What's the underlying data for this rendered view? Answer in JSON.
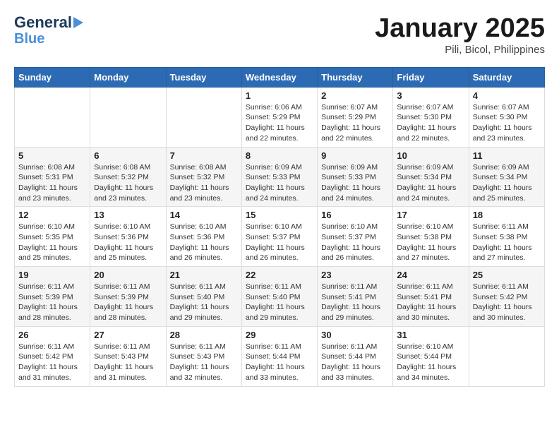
{
  "header": {
    "logo_line1": "General",
    "logo_line2": "Blue",
    "month": "January 2025",
    "location": "Pili, Bicol, Philippines"
  },
  "days_of_week": [
    "Sunday",
    "Monday",
    "Tuesday",
    "Wednesday",
    "Thursday",
    "Friday",
    "Saturday"
  ],
  "weeks": [
    [
      {
        "day": "",
        "info": ""
      },
      {
        "day": "",
        "info": ""
      },
      {
        "day": "",
        "info": ""
      },
      {
        "day": "1",
        "info": "Sunrise: 6:06 AM\nSunset: 5:29 PM\nDaylight: 11 hours and 22 minutes."
      },
      {
        "day": "2",
        "info": "Sunrise: 6:07 AM\nSunset: 5:29 PM\nDaylight: 11 hours and 22 minutes."
      },
      {
        "day": "3",
        "info": "Sunrise: 6:07 AM\nSunset: 5:30 PM\nDaylight: 11 hours and 22 minutes."
      },
      {
        "day": "4",
        "info": "Sunrise: 6:07 AM\nSunset: 5:30 PM\nDaylight: 11 hours and 23 minutes."
      }
    ],
    [
      {
        "day": "5",
        "info": "Sunrise: 6:08 AM\nSunset: 5:31 PM\nDaylight: 11 hours and 23 minutes."
      },
      {
        "day": "6",
        "info": "Sunrise: 6:08 AM\nSunset: 5:32 PM\nDaylight: 11 hours and 23 minutes."
      },
      {
        "day": "7",
        "info": "Sunrise: 6:08 AM\nSunset: 5:32 PM\nDaylight: 11 hours and 23 minutes."
      },
      {
        "day": "8",
        "info": "Sunrise: 6:09 AM\nSunset: 5:33 PM\nDaylight: 11 hours and 24 minutes."
      },
      {
        "day": "9",
        "info": "Sunrise: 6:09 AM\nSunset: 5:33 PM\nDaylight: 11 hours and 24 minutes."
      },
      {
        "day": "10",
        "info": "Sunrise: 6:09 AM\nSunset: 5:34 PM\nDaylight: 11 hours and 24 minutes."
      },
      {
        "day": "11",
        "info": "Sunrise: 6:09 AM\nSunset: 5:34 PM\nDaylight: 11 hours and 25 minutes."
      }
    ],
    [
      {
        "day": "12",
        "info": "Sunrise: 6:10 AM\nSunset: 5:35 PM\nDaylight: 11 hours and 25 minutes."
      },
      {
        "day": "13",
        "info": "Sunrise: 6:10 AM\nSunset: 5:36 PM\nDaylight: 11 hours and 25 minutes."
      },
      {
        "day": "14",
        "info": "Sunrise: 6:10 AM\nSunset: 5:36 PM\nDaylight: 11 hours and 26 minutes."
      },
      {
        "day": "15",
        "info": "Sunrise: 6:10 AM\nSunset: 5:37 PM\nDaylight: 11 hours and 26 minutes."
      },
      {
        "day": "16",
        "info": "Sunrise: 6:10 AM\nSunset: 5:37 PM\nDaylight: 11 hours and 26 minutes."
      },
      {
        "day": "17",
        "info": "Sunrise: 6:10 AM\nSunset: 5:38 PM\nDaylight: 11 hours and 27 minutes."
      },
      {
        "day": "18",
        "info": "Sunrise: 6:11 AM\nSunset: 5:38 PM\nDaylight: 11 hours and 27 minutes."
      }
    ],
    [
      {
        "day": "19",
        "info": "Sunrise: 6:11 AM\nSunset: 5:39 PM\nDaylight: 11 hours and 28 minutes."
      },
      {
        "day": "20",
        "info": "Sunrise: 6:11 AM\nSunset: 5:39 PM\nDaylight: 11 hours and 28 minutes."
      },
      {
        "day": "21",
        "info": "Sunrise: 6:11 AM\nSunset: 5:40 PM\nDaylight: 11 hours and 29 minutes."
      },
      {
        "day": "22",
        "info": "Sunrise: 6:11 AM\nSunset: 5:40 PM\nDaylight: 11 hours and 29 minutes."
      },
      {
        "day": "23",
        "info": "Sunrise: 6:11 AM\nSunset: 5:41 PM\nDaylight: 11 hours and 29 minutes."
      },
      {
        "day": "24",
        "info": "Sunrise: 6:11 AM\nSunset: 5:41 PM\nDaylight: 11 hours and 30 minutes."
      },
      {
        "day": "25",
        "info": "Sunrise: 6:11 AM\nSunset: 5:42 PM\nDaylight: 11 hours and 30 minutes."
      }
    ],
    [
      {
        "day": "26",
        "info": "Sunrise: 6:11 AM\nSunset: 5:42 PM\nDaylight: 11 hours and 31 minutes."
      },
      {
        "day": "27",
        "info": "Sunrise: 6:11 AM\nSunset: 5:43 PM\nDaylight: 11 hours and 31 minutes."
      },
      {
        "day": "28",
        "info": "Sunrise: 6:11 AM\nSunset: 5:43 PM\nDaylight: 11 hours and 32 minutes."
      },
      {
        "day": "29",
        "info": "Sunrise: 6:11 AM\nSunset: 5:44 PM\nDaylight: 11 hours and 33 minutes."
      },
      {
        "day": "30",
        "info": "Sunrise: 6:11 AM\nSunset: 5:44 PM\nDaylight: 11 hours and 33 minutes."
      },
      {
        "day": "31",
        "info": "Sunrise: 6:10 AM\nSunset: 5:44 PM\nDaylight: 11 hours and 34 minutes."
      },
      {
        "day": "",
        "info": ""
      }
    ]
  ]
}
